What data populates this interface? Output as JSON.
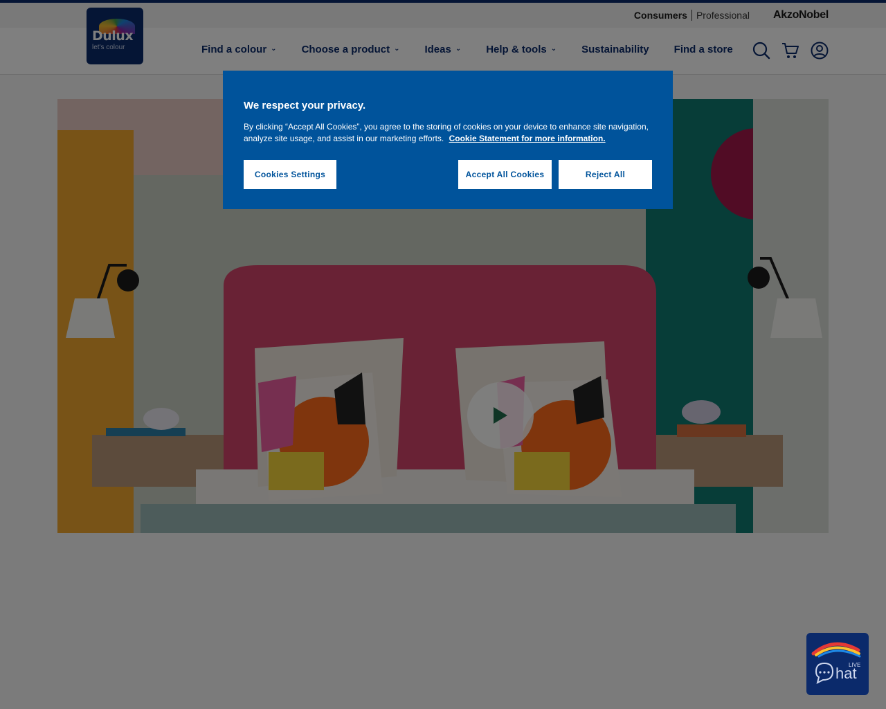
{
  "header": {
    "brand": "Dulux",
    "brand_tagline": "let's colour",
    "audience_active": "Consumers",
    "audience_other": "Professional",
    "corporate": "AkzoNobel",
    "nav": [
      {
        "label": "Find a colour",
        "has_dropdown": true
      },
      {
        "label": "Choose a product",
        "has_dropdown": true
      },
      {
        "label": "Ideas",
        "has_dropdown": true
      },
      {
        "label": "Help & tools",
        "has_dropdown": true
      },
      {
        "label": "Sustainability",
        "has_dropdown": false
      },
      {
        "label": "Find a store",
        "has_dropdown": false
      }
    ],
    "icons": [
      "search-icon",
      "cart-icon",
      "account-icon"
    ]
  },
  "hero": {
    "media": "video",
    "play_icon": "play-icon"
  },
  "cookie_banner": {
    "title": "We respect your privacy.",
    "body": "By clicking “Accept All Cookies”, you agree to the storing of cookies on your device to enhance site navigation, analyze site usage, and assist in our marketing efforts.",
    "link": "Cookie Statement for more information.",
    "settings_label": "Cookies Settings",
    "accept_label": "Accept All Cookies",
    "reject_label": "Reject All"
  },
  "chat": {
    "live": "LIVE",
    "label": "Chat"
  },
  "colors": {
    "brand_navy": "#0b2a6b",
    "cookie_blue": "#00539b",
    "play_green": "#1f6b4a"
  }
}
